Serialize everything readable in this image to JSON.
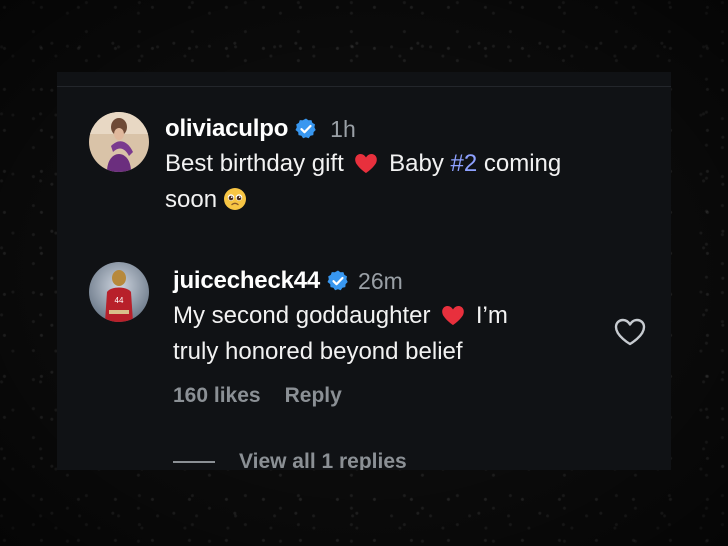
{
  "comments": [
    {
      "username": "oliviaculpo",
      "verified": true,
      "time": "1h",
      "text_parts": {
        "a": "Best birthday gift",
        "b": "Baby",
        "hashtag": "#2",
        "c": "coming",
        "d": "soon"
      },
      "emojis": [
        "red-heart",
        "pleading-face"
      ]
    },
    {
      "username": "juicecheck44",
      "verified": true,
      "time": "26m",
      "text_parts": {
        "a": "My second goddaughter",
        "b": "I’m",
        "c": "truly honored beyond belief"
      },
      "emojis": [
        "red-heart"
      ],
      "likes": "160 likes",
      "reply_label": "Reply",
      "view_replies": "View all 1 replies"
    }
  ],
  "colors": {
    "background": "#0b0b0b",
    "panel": "#101215",
    "text": "#f2f2f2",
    "muted": "#8b9095",
    "hashtag": "#8ea1ff",
    "verified": "#3897f0",
    "heart": "#e8303d"
  },
  "icons": {
    "verified": "verified-badge-icon",
    "like": "heart-outline-icon"
  }
}
